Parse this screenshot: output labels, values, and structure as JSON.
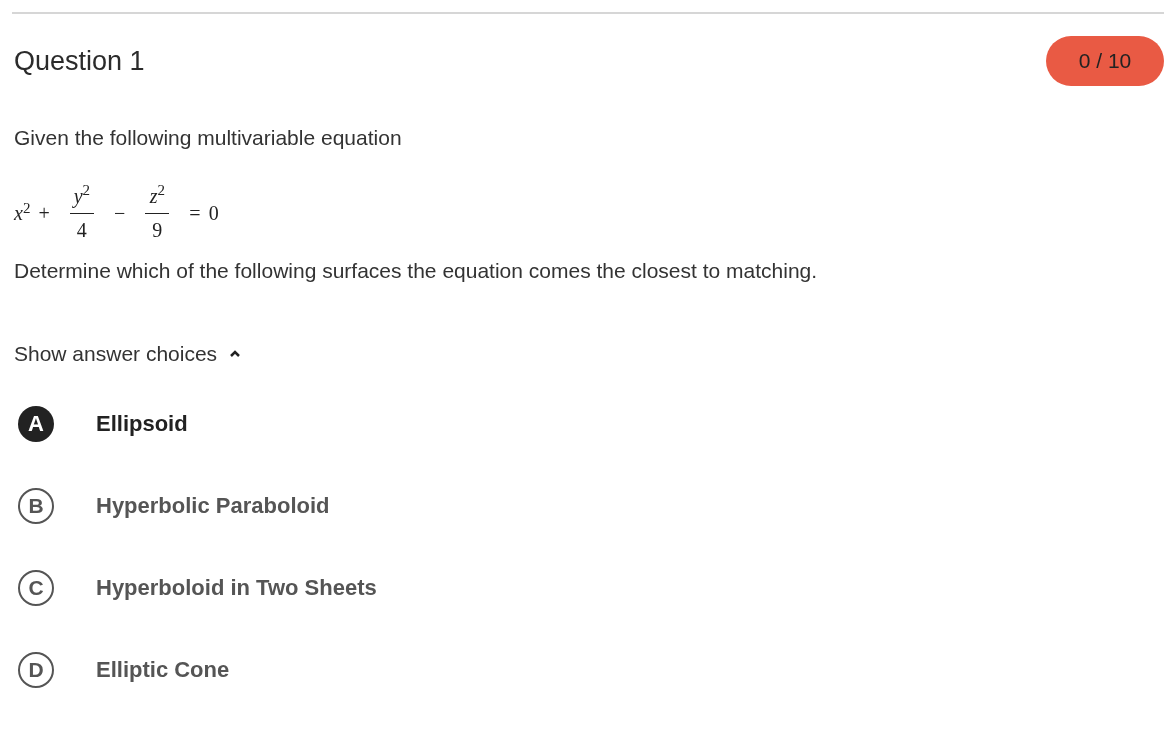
{
  "question": {
    "title": "Question 1",
    "score": "0 / 10"
  },
  "prompt": "Given the following multivariable equation",
  "equation": [
    {
      "kind": "term",
      "text": "*x*$^{2}$"
    },
    {
      "kind": "op",
      "text": "+"
    },
    {
      "kind": "fraction",
      "numerator": "*y*$^{2}$",
      "denominator": "4"
    },
    {
      "kind": "op",
      "text": "−"
    },
    {
      "kind": "fraction",
      "numerator": "*z*$^{2}$",
      "denominator": "9"
    },
    {
      "kind": "op",
      "text": "="
    },
    {
      "kind": "term",
      "text": "0"
    }
  ],
  "instruction": "Determine which of the following surfaces the equation comes the closest to matching.",
  "answer_toggle": {
    "label": "Show answer choices",
    "expanded": true
  },
  "choices": [
    {
      "letter": "A",
      "text": "Ellipsoid",
      "selected": true
    },
    {
      "letter": "B",
      "text": "Hyperbolic Paraboloid",
      "selected": false
    },
    {
      "letter": "C",
      "text": "Hyperboloid in Two Sheets",
      "selected": false
    },
    {
      "letter": "D",
      "text": "Elliptic Cone",
      "selected": false
    }
  ]
}
